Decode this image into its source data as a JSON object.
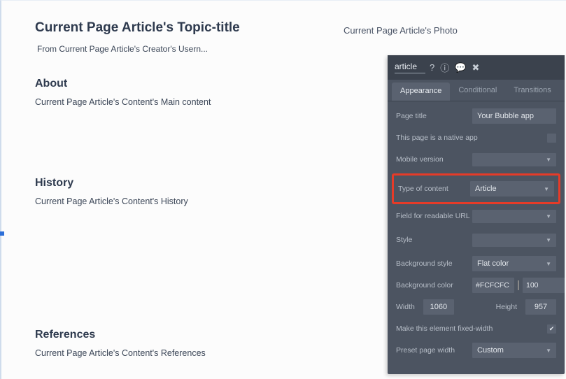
{
  "page": {
    "topic_title": "Current Page Article's Topic-title",
    "photo_text": "Current Page Article's Photo",
    "from_line": "From Current Page Article's Creator's Usern...",
    "sections": {
      "about": {
        "title": "About",
        "content": "Current Page Article's Content's Main content"
      },
      "history": {
        "title": "History",
        "content": "Current Page Article's Content's History"
      },
      "references": {
        "title": "References",
        "content": "Current Page Article's Content's References"
      }
    }
  },
  "inspector": {
    "title": "article",
    "tabs": {
      "appearance": "Appearance",
      "conditional": "Conditional",
      "transitions": "Transitions"
    },
    "labels": {
      "page_title": "Page title",
      "native_app": "This page is a native app",
      "mobile_version": "Mobile version",
      "type_of_content": "Type of content",
      "field_readable_url": "Field for readable URL",
      "style": "Style",
      "background_style": "Background style",
      "background_color": "Background color",
      "width": "Width",
      "height": "Height",
      "fixed_width": "Make this element fixed-width",
      "preset_page_width": "Preset page width"
    },
    "values": {
      "page_title": "Your Bubble app",
      "native_app_checked": "",
      "mobile_version": "",
      "type_of_content": "Article",
      "field_readable_url": "",
      "style": "",
      "background_style": "Flat color",
      "background_color": "#FCFCFC",
      "background_alpha": "100",
      "width": "1060",
      "height": "957",
      "fixed_width_checked": "✔",
      "preset_page_width": "Custom"
    }
  }
}
